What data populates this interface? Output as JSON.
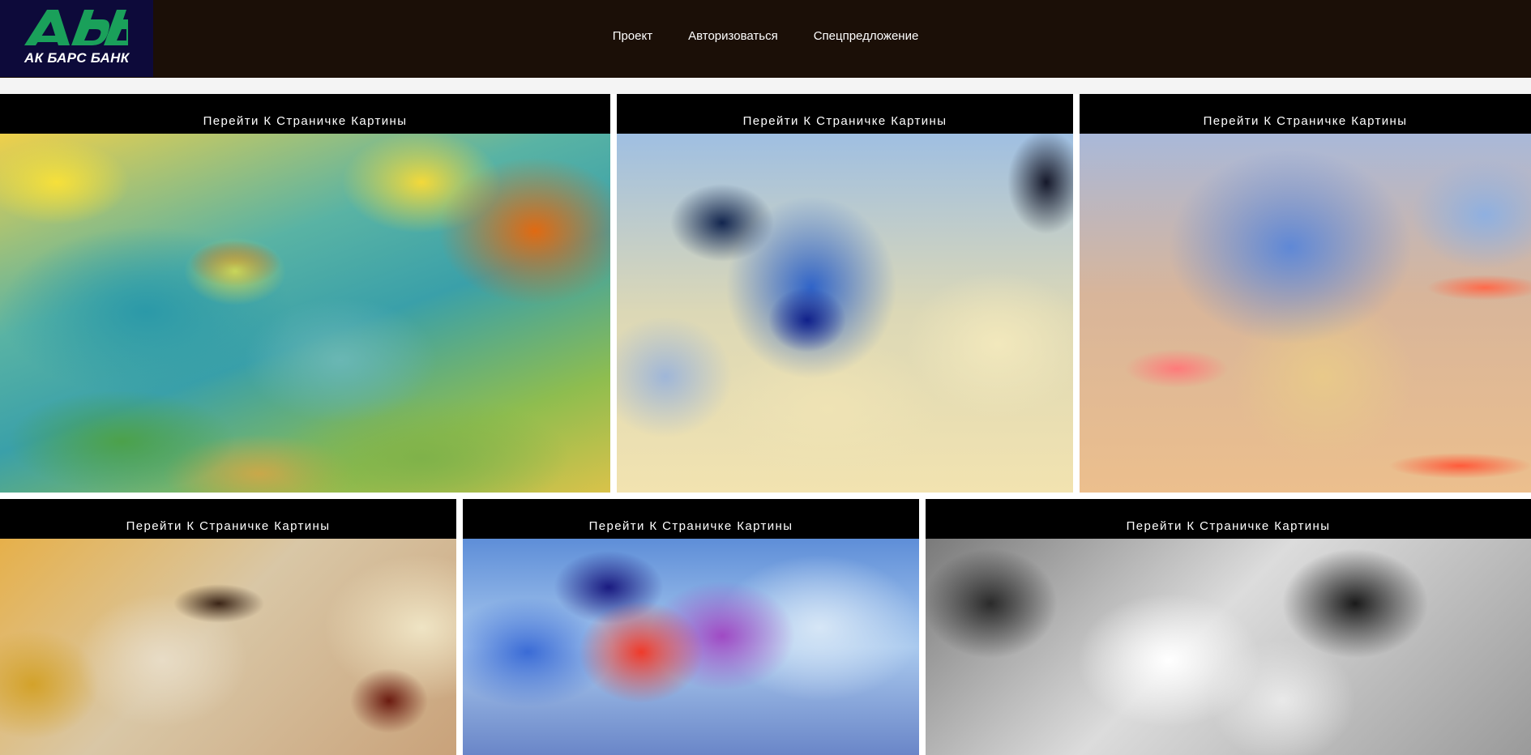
{
  "header": {
    "logo_text": "АК БАРС БАНК",
    "nav": [
      {
        "label": "Проект"
      },
      {
        "label": "Авторизоваться"
      },
      {
        "label": "Спецпредложение"
      }
    ]
  },
  "gallery": {
    "cards": [
      {
        "link_label": "Перейти К Страничке Картины"
      },
      {
        "link_label": "Перейти К Страничке Картины"
      },
      {
        "link_label": "Перейти К Страничке Картины"
      },
      {
        "link_label": "Перейти К Страничке Картины"
      },
      {
        "link_label": "Перейти К Страничке Картины"
      },
      {
        "link_label": "Перейти К Страничке Картины"
      }
    ]
  },
  "colors": {
    "header_bg": "#1b0f07",
    "logo_bg": "#0d0a3a",
    "logo_green": "#1aa05a",
    "card_head_bg": "#000000"
  }
}
